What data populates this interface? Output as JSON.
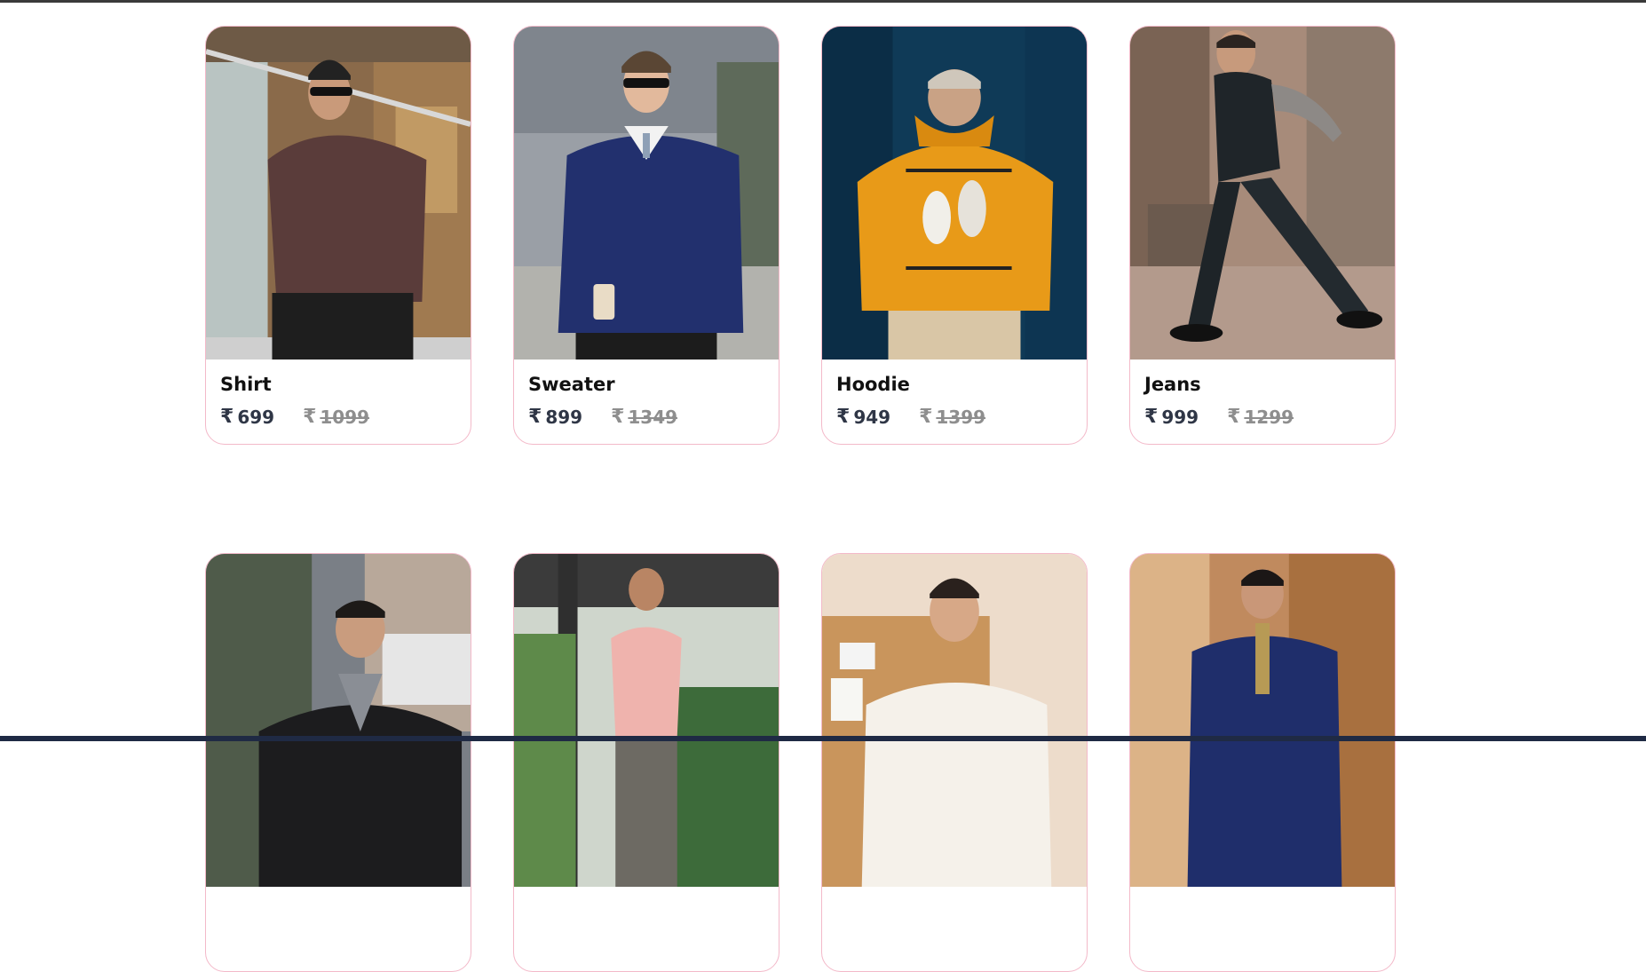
{
  "currency_icon": "rupee-icon",
  "products": [
    {
      "name": "Shirt",
      "price": "699",
      "old_price": "1099",
      "currency": "₹"
    },
    {
      "name": "Sweater",
      "price": "899",
      "old_price": "1349",
      "currency": "₹"
    },
    {
      "name": "Hoodie",
      "price": "949",
      "old_price": "1399",
      "currency": "₹"
    },
    {
      "name": "Jeans",
      "price": "999",
      "old_price": "1299",
      "currency": "₹"
    }
  ],
  "colors": {
    "card_border": "#f3b9c9",
    "price": "#2f3646",
    "old_price": "#8e8e8e"
  }
}
